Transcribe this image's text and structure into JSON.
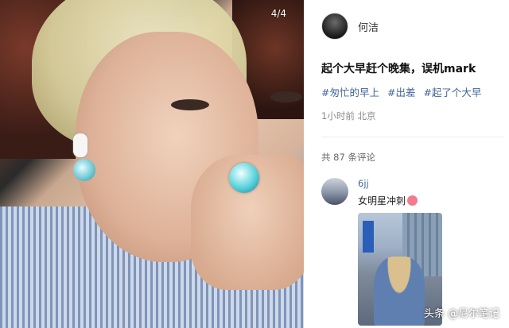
{
  "photo": {
    "page_indicator": "4/4"
  },
  "author": {
    "name": "何洁",
    "avatar_icon": "avatar-icon"
  },
  "post": {
    "title": "起个大早赶个晚集，误机mark",
    "tags": [
      "#匆忙的早上",
      "#出差",
      "#起了个大早"
    ],
    "meta": "1小时前 北京"
  },
  "comments": {
    "count_label": "共 87 条评论",
    "items": [
      {
        "user": "6jj",
        "text": "女明星冲刺",
        "emoji_icon": "face-emoji-icon"
      }
    ]
  },
  "watermark": "头条 @尼尔笔记",
  "colors": {
    "tag_blue": "#406599",
    "meta_gray": "#8a8a8a"
  }
}
